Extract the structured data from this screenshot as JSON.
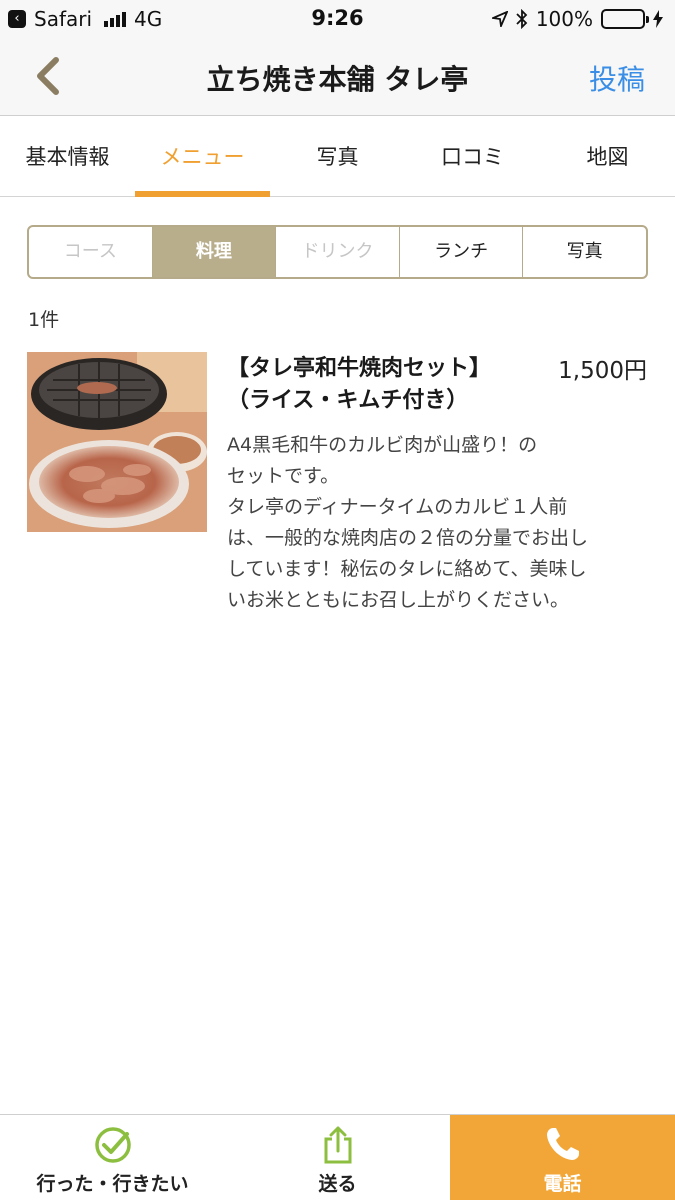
{
  "status_bar": {
    "app_back": "Safari",
    "network": "4G",
    "time": "9:26",
    "battery": "100%",
    "battery_level": 1.0
  },
  "header": {
    "title": "立ち焼き本舗 タレ亭",
    "post_label": "投稿"
  },
  "tabs": [
    {
      "label": "基本情報",
      "active": false
    },
    {
      "label": "メニュー",
      "active": true
    },
    {
      "label": "写真",
      "active": false
    },
    {
      "label": "口コミ",
      "active": false
    },
    {
      "label": "地図",
      "active": false
    }
  ],
  "segments": [
    {
      "label": "コース",
      "state": "disabled"
    },
    {
      "label": "料理",
      "state": "active"
    },
    {
      "label": "ドリンク",
      "state": "disabled"
    },
    {
      "label": "ランチ",
      "state": "normal"
    },
    {
      "label": "写真",
      "state": "normal"
    }
  ],
  "result_count": "1件",
  "menu_item": {
    "name": "【タレ亭和牛焼肉セット】\n（ライス・キムチ付き）",
    "price": "1,500円",
    "description": "A4黒毛和牛のカルビ肉が山盛り！の\nセットです。\nタレ亭のディナータイムのカルビ１人前\nは、一般的な焼肉店の２倍の分量でお出し\nしています！秘伝のタレに絡めて、美味し\nいお米とともにお召し上がりください。"
  },
  "bottom_bar": {
    "went_label": "行った・行きたい",
    "send_label": "送る",
    "call_label": "電話"
  },
  "colors": {
    "accent": "#f0a030",
    "link": "#3a8ee6",
    "segment_active": "#b9ae8c",
    "call_bg": "#f2a637",
    "check_green": "#8cbf3f"
  }
}
